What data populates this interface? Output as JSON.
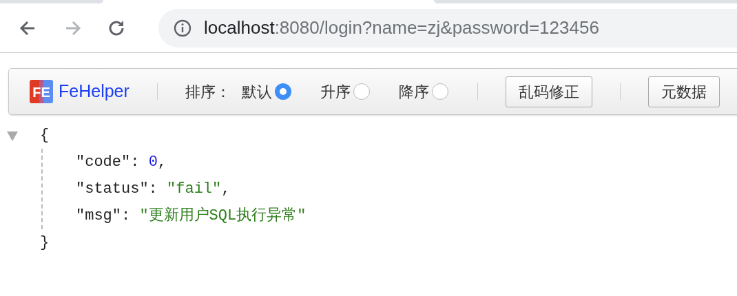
{
  "browser": {
    "nav": [
      {
        "kind": "back",
        "disabled": false
      },
      {
        "kind": "forward",
        "disabled": true
      },
      {
        "kind": "reload",
        "disabled": false
      }
    ],
    "url_host": "localhost",
    "url_rest": ":8080/login?name=zj&password=123456"
  },
  "toolbar": {
    "logo_mark": "FE",
    "logo_text": "FeHelper",
    "sort_label": "排序：",
    "sort_options": [
      {
        "label": "默认",
        "selected": true
      },
      {
        "label": "升序",
        "selected": false
      },
      {
        "label": "降序",
        "selected": false
      }
    ],
    "buttons": [
      "乱码修正",
      "元数据"
    ]
  },
  "json_view": {
    "expanded": true,
    "open": "{",
    "close": "}",
    "entries": [
      {
        "key": "\"code\":",
        "value": "0",
        "trail": ",",
        "kind": "number"
      },
      {
        "key": "\"status\":",
        "value": "\"fail\"",
        "trail": ",",
        "kind": "string"
      },
      {
        "key": "\"msg\":",
        "value": "\"更新用户SQL执行异常\"",
        "kind": "string"
      }
    ]
  }
}
